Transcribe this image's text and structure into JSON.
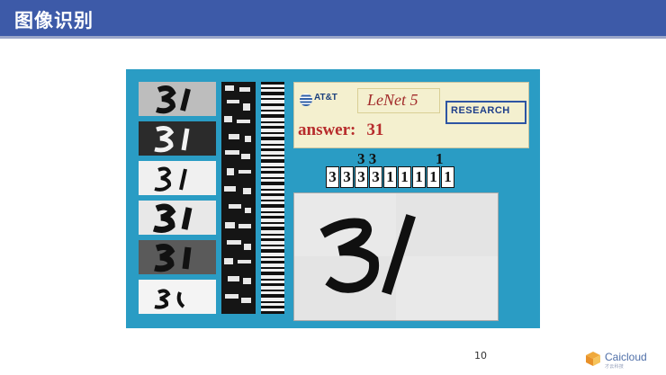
{
  "header": {
    "title": "图像识别"
  },
  "figure": {
    "banner": {
      "brand": "AT&T",
      "model_name": "LeNet 5",
      "research_label": "RESEARCH",
      "answer_label": "answer:",
      "answer_value": "31"
    },
    "segment_labels": {
      "left": "3 3",
      "right": "1"
    },
    "segments": [
      "3",
      "3",
      "3",
      "3",
      "1",
      "1",
      "1",
      "1",
      "1"
    ]
  },
  "footer": {
    "page_number": "10",
    "logo_text": "Caicloud",
    "logo_sub": "才云科技"
  },
  "colors": {
    "header": "#3d5aa8",
    "figure_bg": "#2a9cc4",
    "answer_red": "#b72c2c",
    "banner_bg": "#f4f0cf"
  }
}
